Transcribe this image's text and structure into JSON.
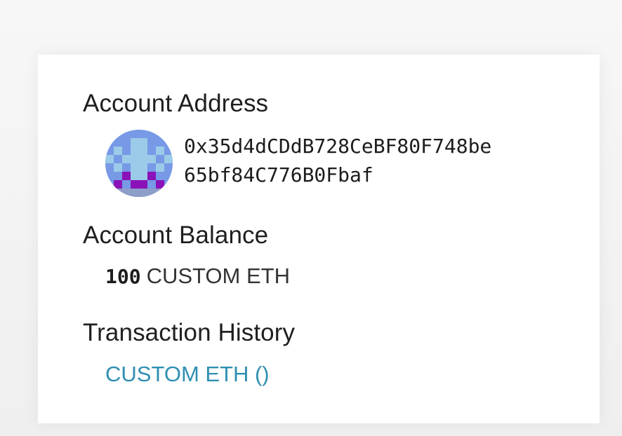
{
  "account": {
    "address_title": "Account Address",
    "address_line_1": "0x35d4dCDdB728CeBF80F748be",
    "address_line_2": "65bf84C776B0Fbaf",
    "avatar_icon": "identicon-avatar",
    "avatar_colors": {
      "primary": "#7799e6",
      "secondary": "#9bcbe8",
      "accent": "#8a12b8"
    }
  },
  "balance": {
    "title": "Account Balance",
    "amount": "100",
    "unit": "CUSTOM ETH"
  },
  "history": {
    "title": "Transaction History",
    "link_text": "CUSTOM ETH ()"
  },
  "colors": {
    "link": "#2f8fb2",
    "card": "#ffffff",
    "background": "#f2f2f2"
  }
}
